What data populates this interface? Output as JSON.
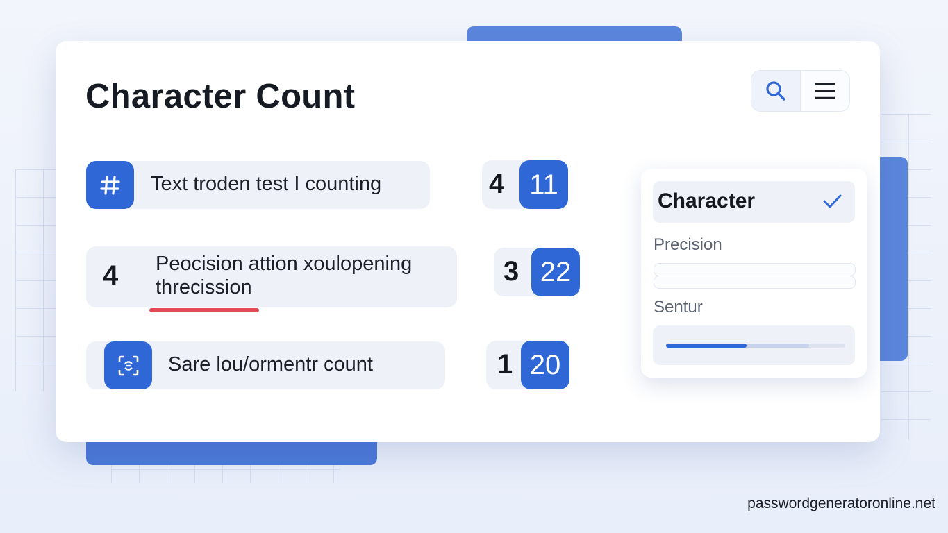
{
  "header": {
    "title": "Character Count"
  },
  "toolbar": {
    "search_icon": "search-icon",
    "menu_icon": "hamburger-menu-icon"
  },
  "rows": [
    {
      "icon": "hash-icon",
      "text": "Text troden test I counting",
      "count_left": "4",
      "count_right": "11"
    },
    {
      "lead_number": "4",
      "text_line1": "Peocision attion xoulopening",
      "text_line2": "threcission",
      "count_left": "3",
      "count_right": "22"
    },
    {
      "icon": "scan-icon",
      "text": "Sare lou/ormentr count",
      "count_left": "1",
      "count_right": "20"
    }
  ],
  "panel": {
    "selected_option": "Character",
    "precision_label": "Precision",
    "sentur_label": "Sentur",
    "slider_value": 0.45,
    "slider_secondary": 0.8
  },
  "watermark": "passwordgeneratoronline.net",
  "colors": {
    "accent": "#2f67d6",
    "underline": "#e24a58"
  }
}
